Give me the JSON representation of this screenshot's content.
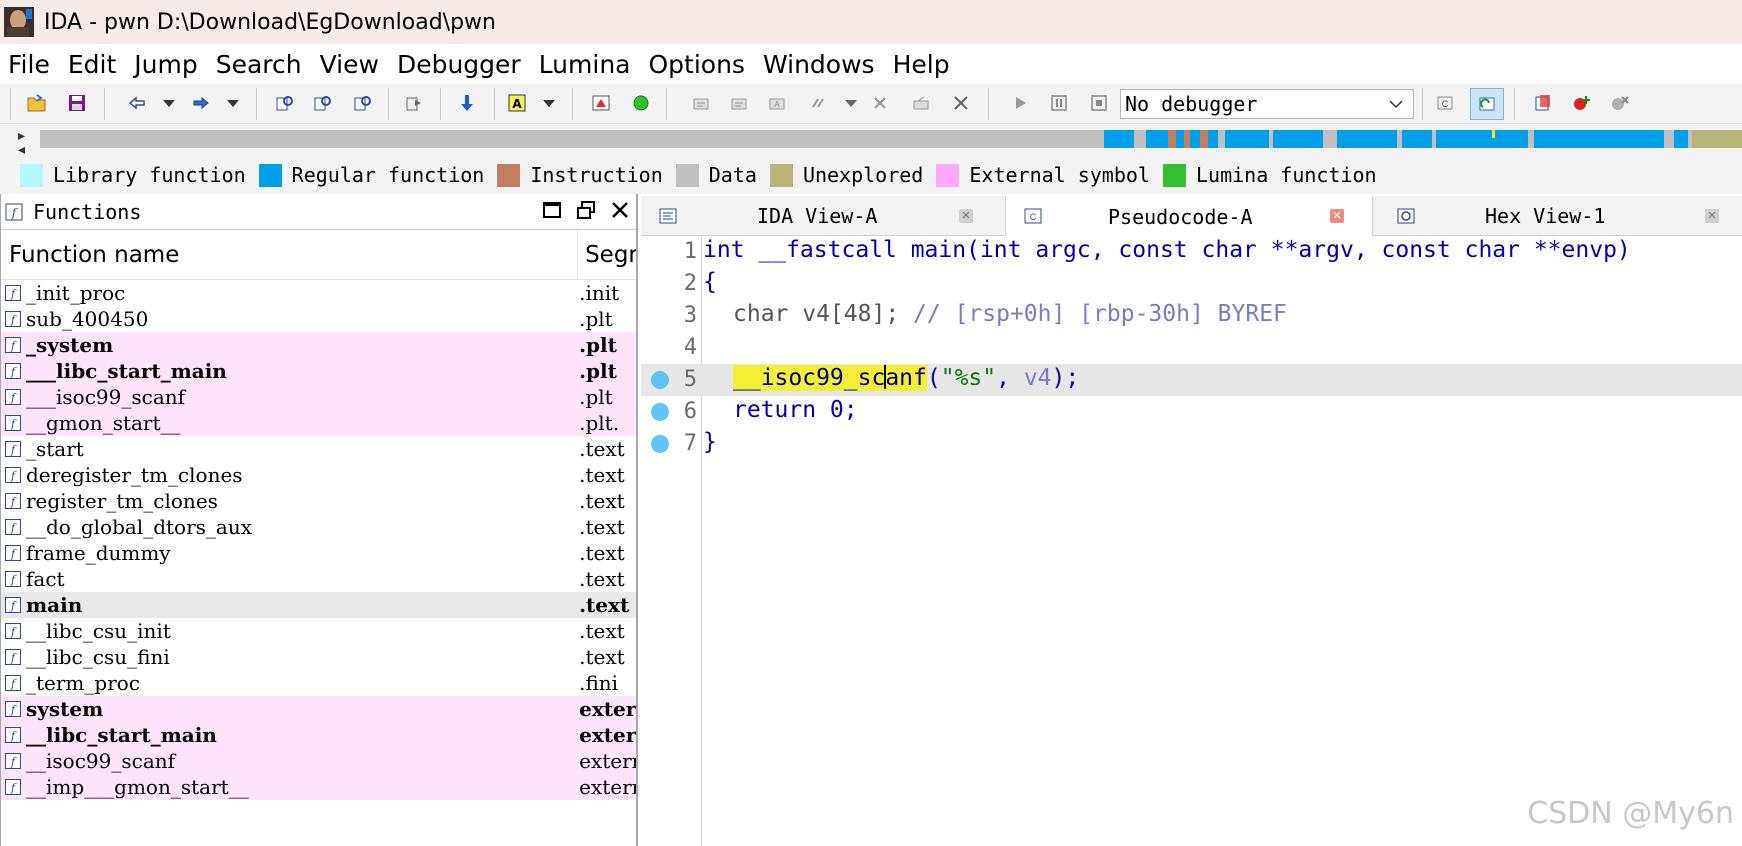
{
  "window": {
    "title": "IDA - pwn D:\\Download\\EgDownload\\pwn"
  },
  "menu": [
    "File",
    "Edit",
    "Jump",
    "Search",
    "View",
    "Debugger",
    "Lumina",
    "Options",
    "Windows",
    "Help"
  ],
  "toolbar": {
    "debugger_select": "No debugger"
  },
  "legend": [
    {
      "label": "Library function",
      "color": "#b2f9ff"
    },
    {
      "label": "Regular function",
      "color": "#00a0e8"
    },
    {
      "label": "Instruction",
      "color": "#c08060"
    },
    {
      "label": "Data",
      "color": "#c0c0c0"
    },
    {
      "label": "Unexplored",
      "color": "#b8b47a"
    },
    {
      "label": "External symbol",
      "color": "#ffa8f8"
    },
    {
      "label": "Lumina function",
      "color": "#30c030"
    }
  ],
  "functions_panel": {
    "title": "Functions",
    "col_name": "Function name",
    "col_segment": "Segm",
    "rows": [
      {
        "name": "_init_proc",
        "segment": ".init",
        "style": "normal"
      },
      {
        "name": "sub_400450",
        "segment": ".plt",
        "style": "normal"
      },
      {
        "name": "_system",
        "segment": ".plt",
        "style": "pink-bold"
      },
      {
        "name": "___libc_start_main",
        "segment": ".plt",
        "style": "pink-bold"
      },
      {
        "name": "___isoc99_scanf",
        "segment": ".plt",
        "style": "pink"
      },
      {
        "name": "__gmon_start__",
        "segment": ".plt.",
        "style": "pink"
      },
      {
        "name": "_start",
        "segment": ".text",
        "style": "normal"
      },
      {
        "name": "deregister_tm_clones",
        "segment": ".text",
        "style": "normal"
      },
      {
        "name": "register_tm_clones",
        "segment": ".text",
        "style": "normal"
      },
      {
        "name": "__do_global_dtors_aux",
        "segment": ".text",
        "style": "normal"
      },
      {
        "name": "frame_dummy",
        "segment": ".text",
        "style": "normal"
      },
      {
        "name": "fact",
        "segment": ".text",
        "style": "normal"
      },
      {
        "name": "main",
        "segment": ".text",
        "style": "selected-bold"
      },
      {
        "name": "__libc_csu_init",
        "segment": ".text",
        "style": "normal"
      },
      {
        "name": "__libc_csu_fini",
        "segment": ".text",
        "style": "normal"
      },
      {
        "name": "_term_proc",
        "segment": ".fini",
        "style": "normal"
      },
      {
        "name": "system",
        "segment": "extern",
        "style": "pink-bold"
      },
      {
        "name": "__libc_start_main",
        "segment": "extern",
        "style": "pink-bold"
      },
      {
        "name": "__isoc99_scanf",
        "segment": "extern",
        "style": "pink"
      },
      {
        "name": "__imp___gmon_start__",
        "segment": "extern",
        "style": "pink"
      }
    ]
  },
  "tabs": [
    {
      "label": "IDA View-A",
      "active": false
    },
    {
      "label": "Pseudocode-A",
      "active": true
    },
    {
      "label": "Hex View-1",
      "active": false
    }
  ],
  "pseudocode": {
    "lines": [
      {
        "n": "1",
        "text": "int __fastcall main(int argc, const char **argv, const char **envp)"
      },
      {
        "n": "2",
        "text": "{"
      },
      {
        "n": "3",
        "a": "char v4[48]; ",
        "b": "// [rsp+0h] [rbp-30h] BYREF"
      },
      {
        "n": "4",
        "text": ""
      },
      {
        "n": "5",
        "fn1": "__isoc99_sc",
        "fn2": "anf",
        "p1": "(",
        "str": "\"%s\"",
        "p2": ", ",
        "var": "v4",
        "p3": ");"
      },
      {
        "n": "6",
        "text": "return 0;"
      },
      {
        "n": "7",
        "text": "}"
      }
    ]
  },
  "watermark": "CSDN @My6n"
}
